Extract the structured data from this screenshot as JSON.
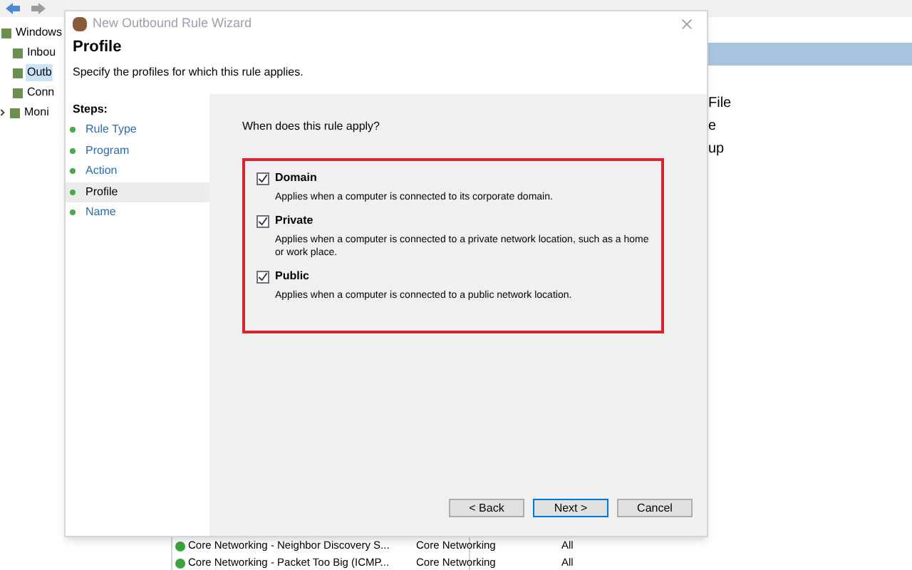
{
  "background_app": {
    "tree": [
      {
        "label": "Windows",
        "selected": false,
        "children": [
          {
            "label": "Inbou",
            "selected": false
          },
          {
            "label": "Outb",
            "selected": true
          },
          {
            "label": "Conn",
            "selected": false
          },
          {
            "label": "Moni",
            "selected": false,
            "expandable": true
          }
        ]
      }
    ],
    "actions": [
      "File",
      "e",
      "up"
    ],
    "rules": [
      {
        "name": "Core Networking - Neighbor Discovery S...",
        "group": "Core Networking",
        "profile": "All",
        "enabled": true
      },
      {
        "name": "Core Networking - Packet Too Big (ICMP...",
        "group": "Core Networking",
        "profile": "All",
        "enabled": true
      }
    ]
  },
  "dialog": {
    "title": "New Outbound Rule Wizard",
    "heading": "Profile",
    "subheading": "Specify the profiles for which this rule applies.",
    "steps_title": "Steps:",
    "steps": [
      {
        "label": "Rule Type",
        "selected": false
      },
      {
        "label": "Program",
        "selected": false
      },
      {
        "label": "Action",
        "selected": false
      },
      {
        "label": "Profile",
        "selected": true
      },
      {
        "label": "Name",
        "selected": false
      }
    ],
    "question": "When does this rule apply?",
    "options": [
      {
        "label": "Domain",
        "description": "Applies when a computer is connected to its corporate domain.",
        "checked": true
      },
      {
        "label": "Private",
        "description": "Applies when a computer is connected to a private network location, such as a home or work place.",
        "checked": true
      },
      {
        "label": "Public",
        "description": "Applies when a computer is connected to a public network location.",
        "checked": true
      }
    ],
    "buttons": [
      {
        "label": "< Back",
        "default": false
      },
      {
        "label": "Next >",
        "default": true
      },
      {
        "label": "Cancel",
        "default": false
      }
    ]
  }
}
